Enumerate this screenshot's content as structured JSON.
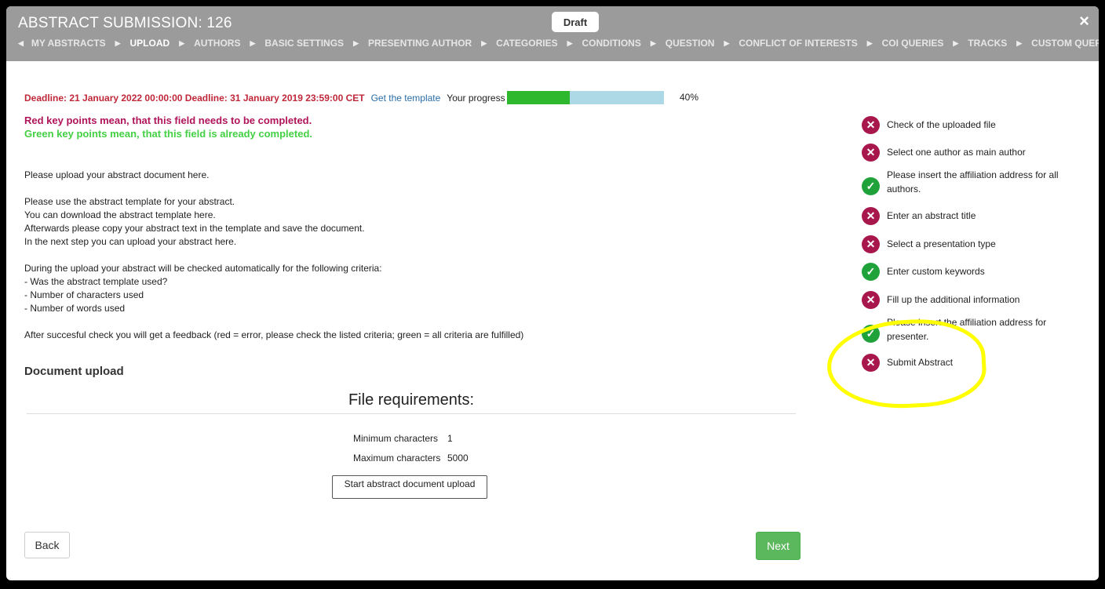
{
  "header": {
    "title": "ABSTRACT SUBMISSION: 126",
    "status": "Draft",
    "close_symbol": "×",
    "steps": [
      "MY ABSTRACTS",
      "UPLOAD",
      "AUTHORS",
      "BASIC SETTINGS",
      "PRESENTING AUTHOR",
      "CATEGORIES",
      "CONDITIONS",
      "QUESTION",
      "CONFLICT OF INTERESTS",
      "COI QUERIES",
      "TRACKS",
      "CUSTOM QUERIES",
      "SUMMARY"
    ],
    "active_step": "UPLOAD"
  },
  "deadline": "Deadline: 21 January 2022 00:00:00 Deadline: 31 January 2019 23:59:00 CET",
  "template_link": "Get the template",
  "progress": {
    "label": "Your progress",
    "percent_text": "40%",
    "value": 0.4
  },
  "legend": {
    "red": "Red key points mean, that this field needs to be completed.",
    "green": "Green key points mean, that this field is already completed."
  },
  "info": {
    "p1": "Please upload your abstract document here.",
    "p2": "Please use the abstract template for your abstract.",
    "p3": "You can download the abstract template here.",
    "p4": "Afterwards please copy your abstract text in the template and save the document.",
    "p5": "In the next step you can upload your abstract here.",
    "p6": "During the upload your abstract will be checked automatically for the following criteria:",
    "p7": "- Was the abstract template used?",
    "p8": "- Number of characters used",
    "p9": "- Number of words used",
    "p10": "After succesful check you will get a feedback (red = error, please check the listed criteria; green = all criteria are fulfilled)"
  },
  "document_upload": {
    "heading": "Document upload",
    "requirements_title": "File requirements:",
    "min_label": "Minimum characters",
    "min_value": "1",
    "max_label": "Maximum characters",
    "max_value": "5000",
    "upload_button": "Start abstract document upload"
  },
  "buttons": {
    "back": "Back",
    "next": "Next"
  },
  "checklist": [
    {
      "text": "Check of the uploaded file",
      "status": "error"
    },
    {
      "text": "Select one author as main author",
      "status": "error"
    },
    {
      "text": "Please insert the affiliation address for all authors.",
      "status": "ok"
    },
    {
      "text": "Enter an abstract title",
      "status": "error"
    },
    {
      "text": "Select a presentation type",
      "status": "error"
    },
    {
      "text": "Enter custom keywords",
      "status": "ok"
    },
    {
      "text": "Fill up the additional information",
      "status": "error"
    },
    {
      "text": "Please insert the affiliation address for presenter.",
      "status": "ok"
    },
    {
      "text": "Submit Abstract",
      "status": "error"
    }
  ],
  "colors": {
    "error": "#a8174b",
    "ok": "#20a23a",
    "progress_fill": "#2eb82e",
    "progress_track": "#add8e6",
    "highlight": "#ffff00"
  }
}
